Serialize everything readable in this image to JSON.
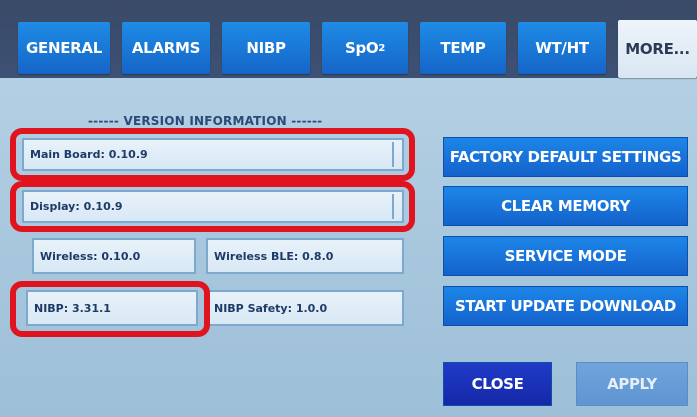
{
  "tabs": [
    {
      "label": "GENERAL"
    },
    {
      "label": "ALARMS"
    },
    {
      "label": "NIBP"
    },
    {
      "label": "SpO",
      "sub": "2"
    },
    {
      "label": "TEMP"
    },
    {
      "label": "WT/HT"
    },
    {
      "label": "MORE...",
      "active": true
    }
  ],
  "version_info": {
    "heading": "------ VERSION INFORMATION ------",
    "main_board": "Main Board: 0.10.9",
    "display": "Display: 0.10.9",
    "wireless": "Wireless: 0.10.0",
    "wireless_ble": "Wireless BLE: 0.8.0",
    "nibp": "NIBP: 3.31.1",
    "nibp_safety": "NIBP Safety: 1.0.0"
  },
  "actions": {
    "factory_default": "FACTORY DEFAULT SETTINGS",
    "clear_memory": "CLEAR MEMORY",
    "service_mode": "SERVICE MODE",
    "start_update": "START UPDATE DOWNLOAD"
  },
  "footer": {
    "close": "CLOSE",
    "apply": "APPLY"
  },
  "colors": {
    "highlight": "#e0141e",
    "button": "#1765cc",
    "background": "#afcce2"
  }
}
